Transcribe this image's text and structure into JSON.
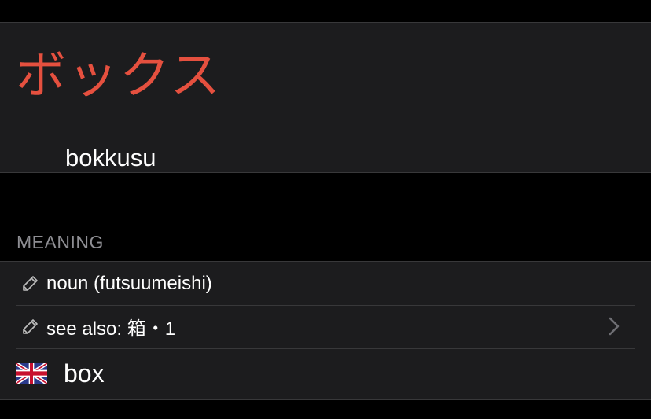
{
  "entry": {
    "kana": "ボックス",
    "romaji": "bokkusu",
    "kana_color": "#e5503f"
  },
  "meaning_section": {
    "header": "MEANING",
    "rows": [
      {
        "icon": "pencil-icon",
        "label": "noun (futsuumeishi)",
        "has_chevron": false
      },
      {
        "icon": "pencil-icon",
        "label": "see also: 箱・1",
        "has_chevron": true
      }
    ],
    "gloss": {
      "icon": "uk-flag-icon",
      "label": "box"
    }
  },
  "colors": {
    "background": "#000000",
    "card": "#1c1c1e",
    "separator": "#38383a",
    "secondary_text": "#8e8e93"
  }
}
